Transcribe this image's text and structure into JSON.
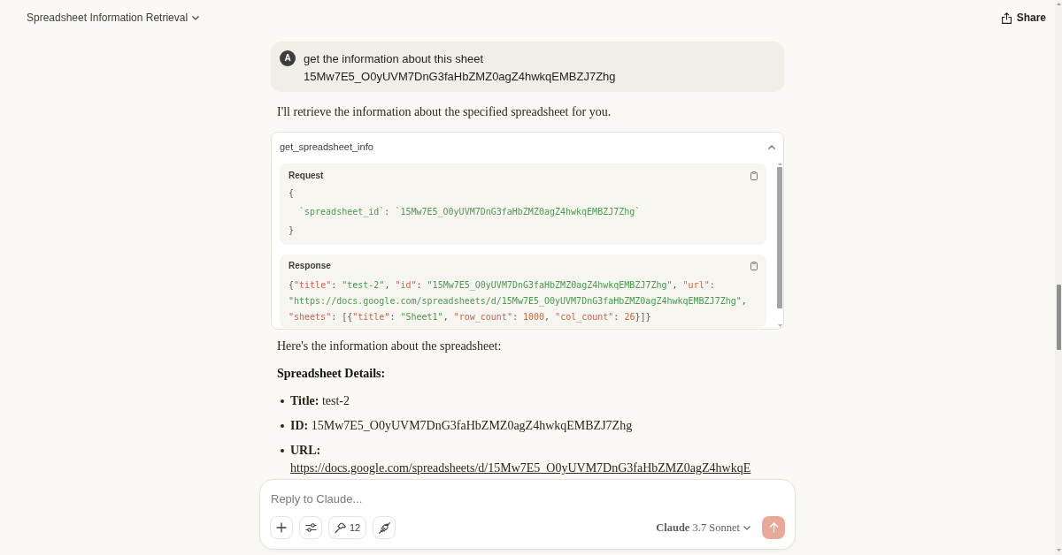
{
  "header": {
    "title": "Spreadsheet Information Retrieval",
    "share": "Share"
  },
  "messages": [
    {
      "kind": "user",
      "avatar": "A",
      "text": "get the information about this sheet 15Mw7E5_O0yUVM7DnG3faHbZMZ0agZ4hwkqEMBZJ7Zhg"
    },
    {
      "kind": "paragraph",
      "text": "I'll retrieve the information about the specified spreadsheet for you."
    },
    {
      "kind": "tool",
      "name": "get_spreadsheet_info",
      "expanded": true,
      "request": {
        "label": "Request",
        "open": "{",
        "entries": [
          {
            "key": "`spreadsheet_id`",
            "separator": ":",
            "value": "`15Mw7E5_O0yUVM7DnG3faHbZMZ0agZ4hwkqEMBZJ7Zhg`"
          }
        ],
        "close": "}"
      },
      "response": {
        "label": "Response",
        "lines": [
          [
            {
              "kind": "punct",
              "text": "{"
            },
            {
              "kind": "key",
              "text": "\"title\""
            },
            {
              "kind": "punct",
              "text": ": "
            },
            {
              "kind": "string",
              "text": "\"test-2\""
            },
            {
              "kind": "punct",
              "text": ", "
            },
            {
              "kind": "key",
              "text": "\"id\""
            },
            {
              "kind": "punct",
              "text": ": "
            },
            {
              "kind": "string",
              "text": "\"15Mw7E5_O0yUVM7DnG3faHbZMZ0agZ4hwkqEMBZJ7Zhg\""
            },
            {
              "kind": "punct",
              "text": ", "
            },
            {
              "kind": "key",
              "text": "\"url\""
            },
            {
              "kind": "punct",
              "text": ":"
            }
          ],
          [
            {
              "kind": "string",
              "text": "\"https://docs.google.com/spreadsheets/d/15Mw7E5_O0yUVM7DnG3faHbZMZ0agZ4hwkqEMBZJ7Zhg\""
            },
            {
              "kind": "punct",
              "text": ","
            }
          ],
          [
            {
              "kind": "key",
              "text": "\"sheets\""
            },
            {
              "kind": "punct",
              "text": ": [{"
            },
            {
              "kind": "key",
              "text": "\"title\""
            },
            {
              "kind": "punct",
              "text": ": "
            },
            {
              "kind": "string",
              "text": "\"Sheet1\""
            },
            {
              "kind": "punct",
              "text": ", "
            },
            {
              "kind": "key",
              "text": "\"row_count\""
            },
            {
              "kind": "punct",
              "text": ": "
            },
            {
              "kind": "number",
              "text": "1000"
            },
            {
              "kind": "punct",
              "text": ", "
            },
            {
              "kind": "key",
              "text": "\"col_count\""
            },
            {
              "kind": "punct",
              "text": ": "
            },
            {
              "kind": "number",
              "text": "26"
            },
            {
              "kind": "punct",
              "text": "}]}"
            }
          ]
        ]
      }
    },
    {
      "kind": "paragraph",
      "text": "Here's the information about the spreadsheet:"
    },
    {
      "kind": "heading",
      "text": "Spreadsheet Details:"
    },
    {
      "kind": "list",
      "items": [
        {
          "text": "**Title:** test-2"
        },
        {
          "text": "**ID:** 15Mw7E5_O0yUVM7DnG3faHbZMZ0agZ4hwkqEMBZJ7Zhg"
        },
        {
          "text": "**URL:**",
          "link": "https://docs.google.com/spreadsheets/d/15Mw7E5_O0yUVM7DnG3faHbZMZ0agZ4hwkqE"
        }
      ]
    }
  ],
  "composer": {
    "placeholder": "Reply to Claude...",
    "tool_count": "12",
    "model": "**Claude** 3.7 Sonnet",
    "send_disabled": true
  }
}
